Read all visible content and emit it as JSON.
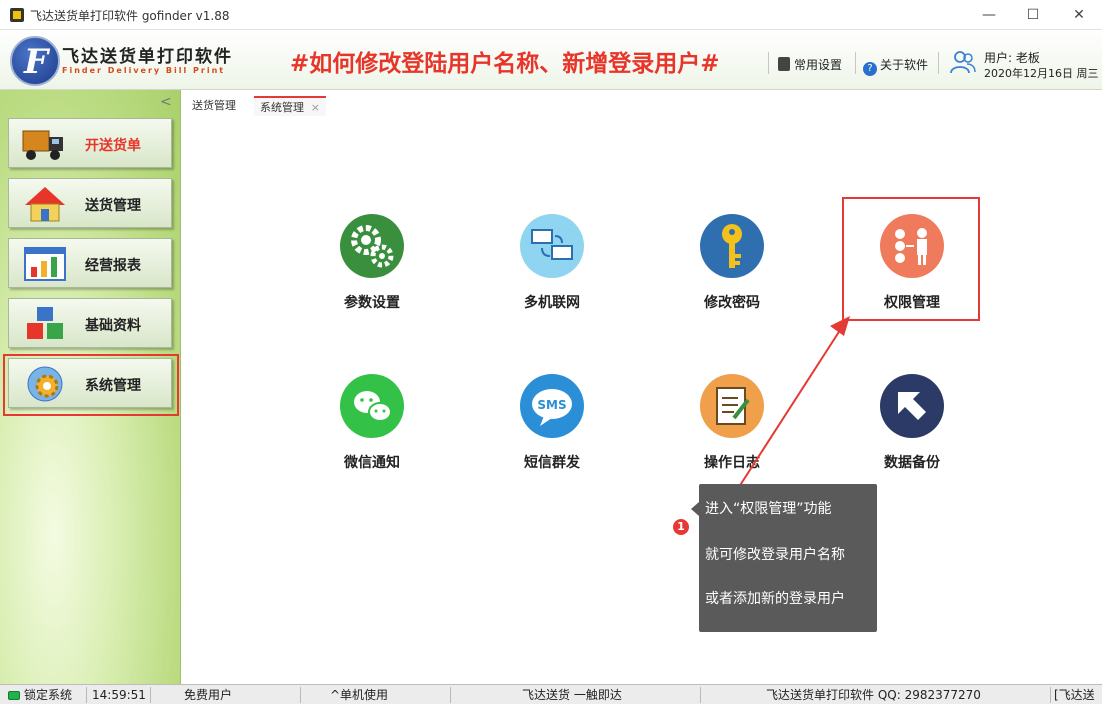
{
  "window": {
    "title": "飞达送货单打印软件  gofinder v1.88",
    "minimize": "—",
    "maximize": "☐",
    "close": "✕"
  },
  "header": {
    "logo_letter": "F",
    "logo_cn": "飞达送货单打印软件",
    "logo_en": "Finder Delivery Bill Print",
    "headline": "#如何修改登陆用户名称、新增登录用户#",
    "settings_label": "常用设置",
    "about_label": "关于软件",
    "user_label": "用户: 老板",
    "date_label": "2020年12月16日 周三"
  },
  "sidebar": {
    "collapse": "<",
    "items": [
      {
        "label": "开送货单",
        "icon": "truck-icon"
      },
      {
        "label": "送货管理",
        "icon": "house-icon"
      },
      {
        "label": "经营报表",
        "icon": "bar-chart-icon"
      },
      {
        "label": "基础资料",
        "icon": "cubes-icon"
      },
      {
        "label": "系统管理",
        "icon": "gear-globe-icon"
      }
    ]
  },
  "tabs": [
    {
      "label": "送货管理"
    },
    {
      "label": "系统管理",
      "close": "×"
    }
  ],
  "tiles": [
    {
      "label": "参数设置",
      "icon": "gears-icon",
      "color": "#3a8f3e"
    },
    {
      "label": "多机联网",
      "icon": "network-icon",
      "color": "#8fd4f0"
    },
    {
      "label": "修改密码",
      "icon": "key-icon",
      "color": "#2f6fb0"
    },
    {
      "label": "权限管理",
      "icon": "permission-icon",
      "color": "#f07a5c"
    },
    {
      "label": "微信通知",
      "icon": "wechat-icon",
      "color": "#34c148"
    },
    {
      "label": "短信群发",
      "icon": "sms-icon",
      "color": "#2a8fd6"
    },
    {
      "label": "操作日志",
      "icon": "log-icon",
      "color": "#f0a04a"
    },
    {
      "label": "数据备份",
      "icon": "backup-arrow-icon",
      "color": "#2b3a66"
    }
  ],
  "callout": {
    "number": "1",
    "line1": "进入“权限管理”功能",
    "line2": "就可修改登录用户名称",
    "line3": "或者添加新的登录用户"
  },
  "status": {
    "lock": "锁定系统",
    "time": "14:59:51",
    "user_type": "免费用户",
    "mode": "^单机使用",
    "slogan": "飞达送货 一触即达",
    "contact": "飞达送货单打印软件 QQ: 2982377270",
    "extra": "[飞达送"
  },
  "colors": {
    "accent_red": "#e53935",
    "sidebar_green": "#bcdc83"
  }
}
